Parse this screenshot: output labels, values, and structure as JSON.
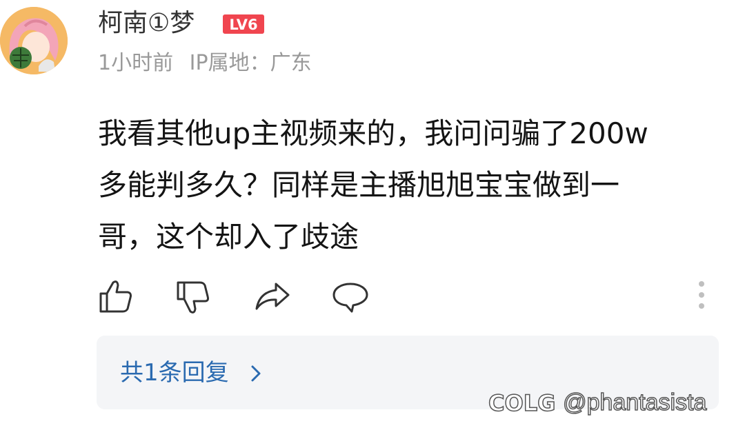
{
  "comment": {
    "author": {
      "name": "柯南①梦",
      "level_badge": "LV6",
      "avatar_icon": "anime-avatar-icon"
    },
    "meta": {
      "time": "1小时前",
      "ip_location": "IP属地：广东"
    },
    "content_lines": [
      "我看其他up主视频来的，我问问骗了200w",
      "多能判多久？同样是主播旭旭宝宝做到一",
      "哥，这个却入了歧途"
    ],
    "actions": {
      "like_icon": "thumbs-up-icon",
      "dislike_icon": "thumbs-down-icon",
      "share_icon": "share-icon",
      "comment_icon": "comment-bubble-icon",
      "more_icon": "more-vertical-icon"
    },
    "replies": {
      "label": "共1条回复",
      "chevron_icon": "chevron-right-icon"
    }
  },
  "watermark": {
    "logo": "COLG",
    "handle": "@phantasista"
  },
  "colors": {
    "badge_red": "#f0454f",
    "reply_blue": "#2a6ab0",
    "meta_gray": "#999999",
    "reply_bg": "#f4f5f7"
  }
}
